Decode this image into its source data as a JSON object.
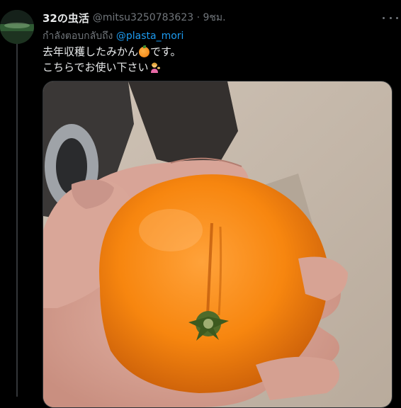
{
  "tweet": {
    "display_name": "32の虫活",
    "handle_time": "@mitsu3250783623 · 9ชม.",
    "reply_prefix": "กำลังตอบกลับถึง",
    "reply_to": "@plasta_mori",
    "text_line1_a": "去年収穫したみかん",
    "text_line1_b": "です。",
    "text_line2": "こちらでお使い下さい",
    "emoji_1": "orange-emoji",
    "emoji_2": "person-tipping-hand-emoji"
  },
  "colors": {
    "background": "#000000",
    "text": "#e7e9ea",
    "secondary": "#71767b",
    "link": "#1d9bf0"
  }
}
